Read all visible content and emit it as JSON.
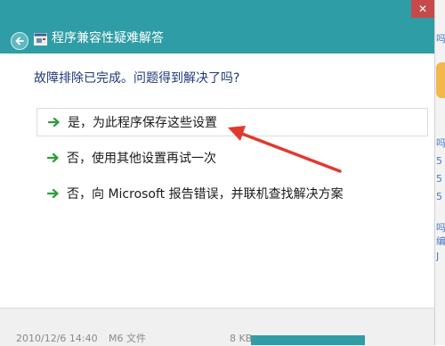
{
  "window": {
    "title": "程序兼容性疑难解答",
    "close_label": "✕"
  },
  "question": "故障排除已完成。问题得到解决了吗?",
  "options": [
    {
      "label": "是，为此程序保存这些设置"
    },
    {
      "label": "否，使用其他设置再试一次"
    },
    {
      "label": "否，向 Microsoft 报告错误，并联机查找解决方案"
    }
  ],
  "background_window": {
    "date_text": "2010/12/6 14:40",
    "type_text": "M6 文件",
    "size_text": "8 KB",
    "sidebar_chars": [
      "吗",
      "吗",
      "5",
      "5",
      "5",
      "吗",
      "编",
      "J"
    ]
  },
  "colors": {
    "titlebar": "#2f9da6",
    "question_text": "#1e3a78",
    "arrow_green": "#2d9d3a",
    "annotation_red": "#e03a2f"
  }
}
